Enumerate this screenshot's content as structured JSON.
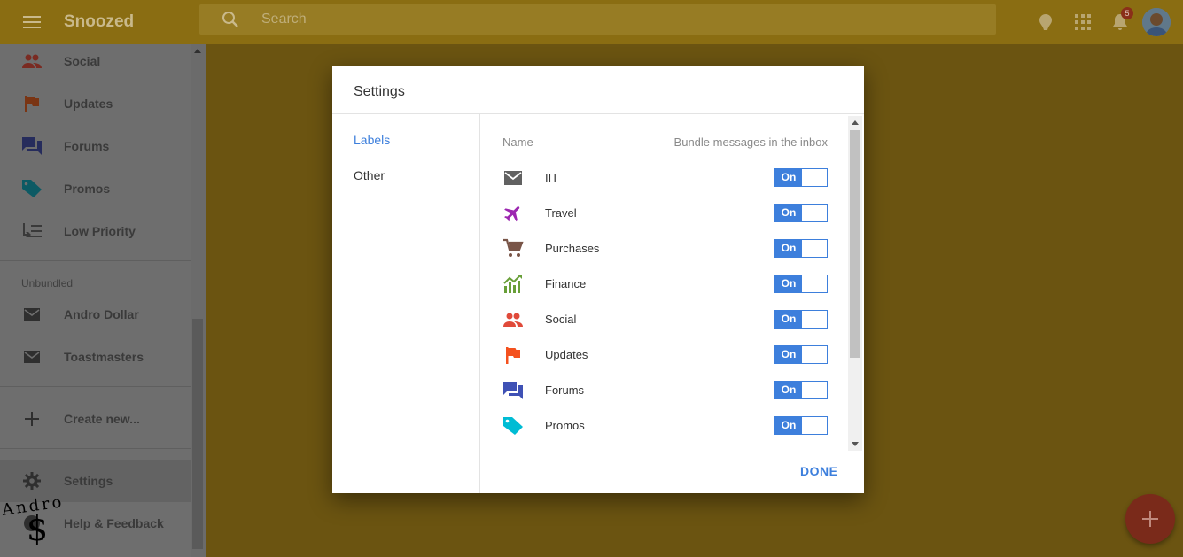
{
  "app": {
    "title": "Snoozed"
  },
  "search": {
    "placeholder": "Search"
  },
  "notifications": {
    "count": "5"
  },
  "sidebar": {
    "items": [
      {
        "label": "Social",
        "icon": "social-icon"
      },
      {
        "label": "Updates",
        "icon": "flag-icon"
      },
      {
        "label": "Forums",
        "icon": "forum-icon"
      },
      {
        "label": "Promos",
        "icon": "tag-icon"
      },
      {
        "label": "Low Priority",
        "icon": "low-priority-icon"
      }
    ],
    "unbundled_title": "Unbundled",
    "unbundled": [
      {
        "label": "Andro Dollar",
        "icon": "mail-icon"
      },
      {
        "label": "Toastmasters",
        "icon": "mail-icon"
      }
    ],
    "create_new": "Create new...",
    "settings": "Settings",
    "help": "Help & Feedback"
  },
  "watermark": {
    "text": "Andro",
    "symbol": "$"
  },
  "dialog": {
    "title": "Settings",
    "nav": [
      {
        "label": "Labels"
      },
      {
        "label": "Other"
      }
    ],
    "header_name": "Name",
    "header_bundle": "Bundle messages in the inbox",
    "rows": [
      {
        "label": "IIT",
        "toggle": "On",
        "icon": "mail-icon",
        "color": "#616161"
      },
      {
        "label": "Travel",
        "toggle": "On",
        "icon": "airplane-icon",
        "color": "#9c27b0"
      },
      {
        "label": "Purchases",
        "toggle": "On",
        "icon": "cart-icon",
        "color": "#795548"
      },
      {
        "label": "Finance",
        "toggle": "On",
        "icon": "chart-icon",
        "color": "#689f38"
      },
      {
        "label": "Social",
        "toggle": "On",
        "icon": "social-icon",
        "color": "#e04a3a"
      },
      {
        "label": "Updates",
        "toggle": "On",
        "icon": "flag-icon",
        "color": "#f4511e"
      },
      {
        "label": "Forums",
        "toggle": "On",
        "icon": "forum-icon",
        "color": "#3f51b5"
      },
      {
        "label": "Promos",
        "toggle": "On",
        "icon": "tag-icon",
        "color": "#00bcd4"
      }
    ],
    "done": "DONE"
  },
  "colors": {
    "accent": "#3d7fdc",
    "topbar": "#8a6d12",
    "fab": "#7a2a1a"
  }
}
